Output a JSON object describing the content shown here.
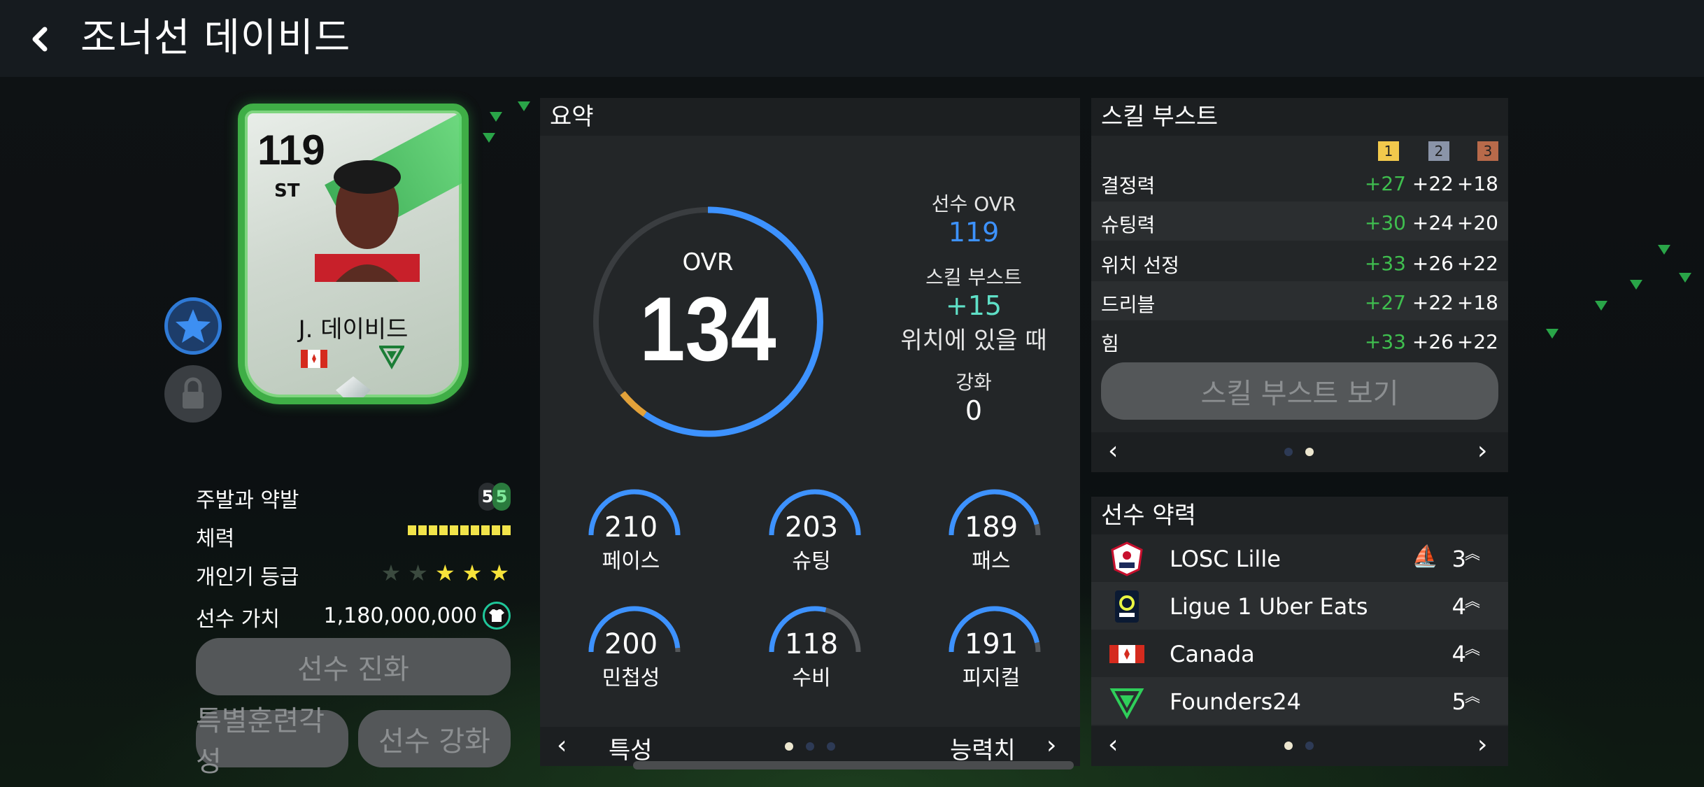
{
  "header": {
    "back_icon": "chevron-left-icon",
    "title": "조너선 데이비드"
  },
  "card": {
    "ovr": "119",
    "position": "ST",
    "name": "J. 데이비드",
    "flag_icon": "canada-flag-icon",
    "club_icon": "founders24-icon"
  },
  "side_buttons": {
    "star_icon": "star-icon",
    "lock_icon": "lock-icon"
  },
  "info": {
    "foot_label": "주발과 약발",
    "foot_main": "5",
    "foot_weak": "5",
    "stamina_label": "체력",
    "stamina_level": 10,
    "popularity_label": "개인기 등급",
    "popularity_stars": 3,
    "popularity_max": 5,
    "value_label": "선수 가치",
    "value": "1,180,000,000"
  },
  "buttons": {
    "evolve": "선수 진화",
    "special_training": "특별훈련각성",
    "enhance": "선수 강화"
  },
  "summary": {
    "title": "요약",
    "ovr_label": "OVR",
    "ovr_value": "134",
    "player_ovr_label": "선수 OVR",
    "player_ovr_value": "119",
    "skill_boost_label": "스킬 부스트",
    "skill_boost_value": "+15",
    "position_note": "위치에 있을 때",
    "enhance_label": "강화",
    "enhance_value": "0",
    "stats": [
      {
        "label": "페이스",
        "value": "210",
        "fill": 1.0
      },
      {
        "label": "슈팅",
        "value": "203",
        "fill": 1.0
      },
      {
        "label": "패스",
        "value": "189",
        "fill": 0.92
      },
      {
        "label": "민첩성",
        "value": "200",
        "fill": 0.97
      },
      {
        "label": "수비",
        "value": "118",
        "fill": 0.58
      },
      {
        "label": "피지컬",
        "value": "191",
        "fill": 0.93
      }
    ],
    "footer_left": "특성",
    "footer_right": "능력치"
  },
  "skill_boost": {
    "title": "스킬 부스트",
    "badges": [
      "1",
      "2",
      "3"
    ],
    "rows": [
      {
        "name": "결정력",
        "v1": "+27",
        "v2": "+22",
        "v3": "+18"
      },
      {
        "name": "슈팅력",
        "v1": "+30",
        "v2": "+24",
        "v3": "+20"
      },
      {
        "name": "위치 선정",
        "v1": "+33",
        "v2": "+26",
        "v3": "+22"
      },
      {
        "name": "드리블",
        "v1": "+27",
        "v2": "+22",
        "v3": "+18"
      },
      {
        "name": "힘",
        "v1": "+33",
        "v2": "+26",
        "v3": "+22"
      }
    ],
    "view_button": "스킬 부스트 보기"
  },
  "weakness": {
    "title": "선수 약력",
    "rows": [
      {
        "name": "LOSC Lille",
        "count": "3",
        "logo": "losc-lille-logo"
      },
      {
        "name": "Ligue 1 Uber Eats",
        "count": "4",
        "logo": "ligue1-logo"
      },
      {
        "name": "Canada",
        "count": "4",
        "logo": "canada-flag-icon"
      },
      {
        "name": "Founders24",
        "count": "5",
        "logo": "founders24-icon"
      }
    ]
  },
  "colors": {
    "accent_blue": "#3d92ff",
    "green": "#3fbf4f",
    "teal": "#5fe0c7",
    "orange": "#e3a23a"
  }
}
